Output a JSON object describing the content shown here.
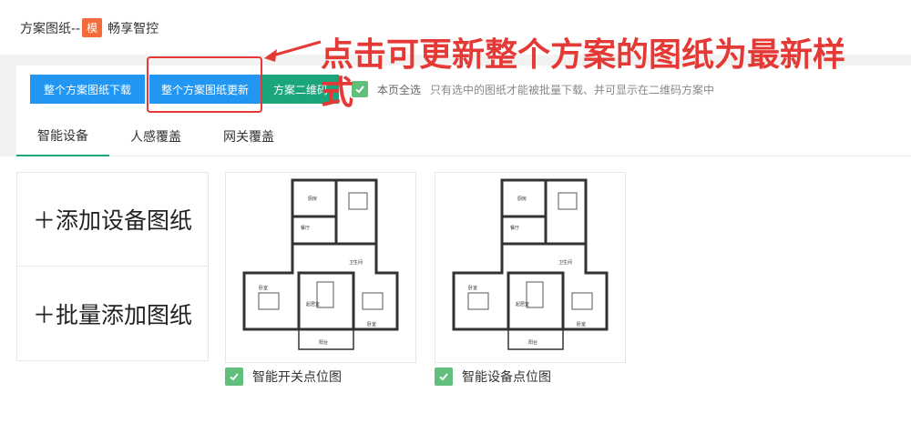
{
  "header": {
    "title": "方案图纸--",
    "badge": "模",
    "project_name": "畅享智控"
  },
  "toolbar": {
    "download_all_label": "整个方案图纸下载",
    "update_all_label": "整个方案图纸更新",
    "qr_label": "方案二维码",
    "select_all_label": "本页全选",
    "hint": "只有选中的图纸才能被批量下载、并可显示在二维码方案中"
  },
  "annotation": {
    "text": "点击可更新整个方案的图纸为最新样式"
  },
  "tabs": [
    {
      "label": "智能设备",
      "active": true
    },
    {
      "label": "人感覆盖",
      "active": false
    },
    {
      "label": "网关覆盖",
      "active": false
    }
  ],
  "add_panel": {
    "add_device_drawing": "＋添加设备图纸",
    "batch_add_drawing": "＋批量添加图纸"
  },
  "drawings": [
    {
      "caption": "智能开关点位图",
      "checked": true
    },
    {
      "caption": "智能设备点位图",
      "checked": true
    }
  ],
  "floorplan_labels": {
    "kitchen": "厨房",
    "dining": "餐厅",
    "bathroom": "卫生间",
    "bedroom": "卧室",
    "living": "起居室",
    "balcony": "阳台"
  },
  "colors": {
    "primary_blue": "#2196f3",
    "green": "#1aa57d",
    "checkbox_green": "#5fbf7b",
    "annotation_red": "#e53935",
    "badge_orange": "#f26b3a"
  }
}
